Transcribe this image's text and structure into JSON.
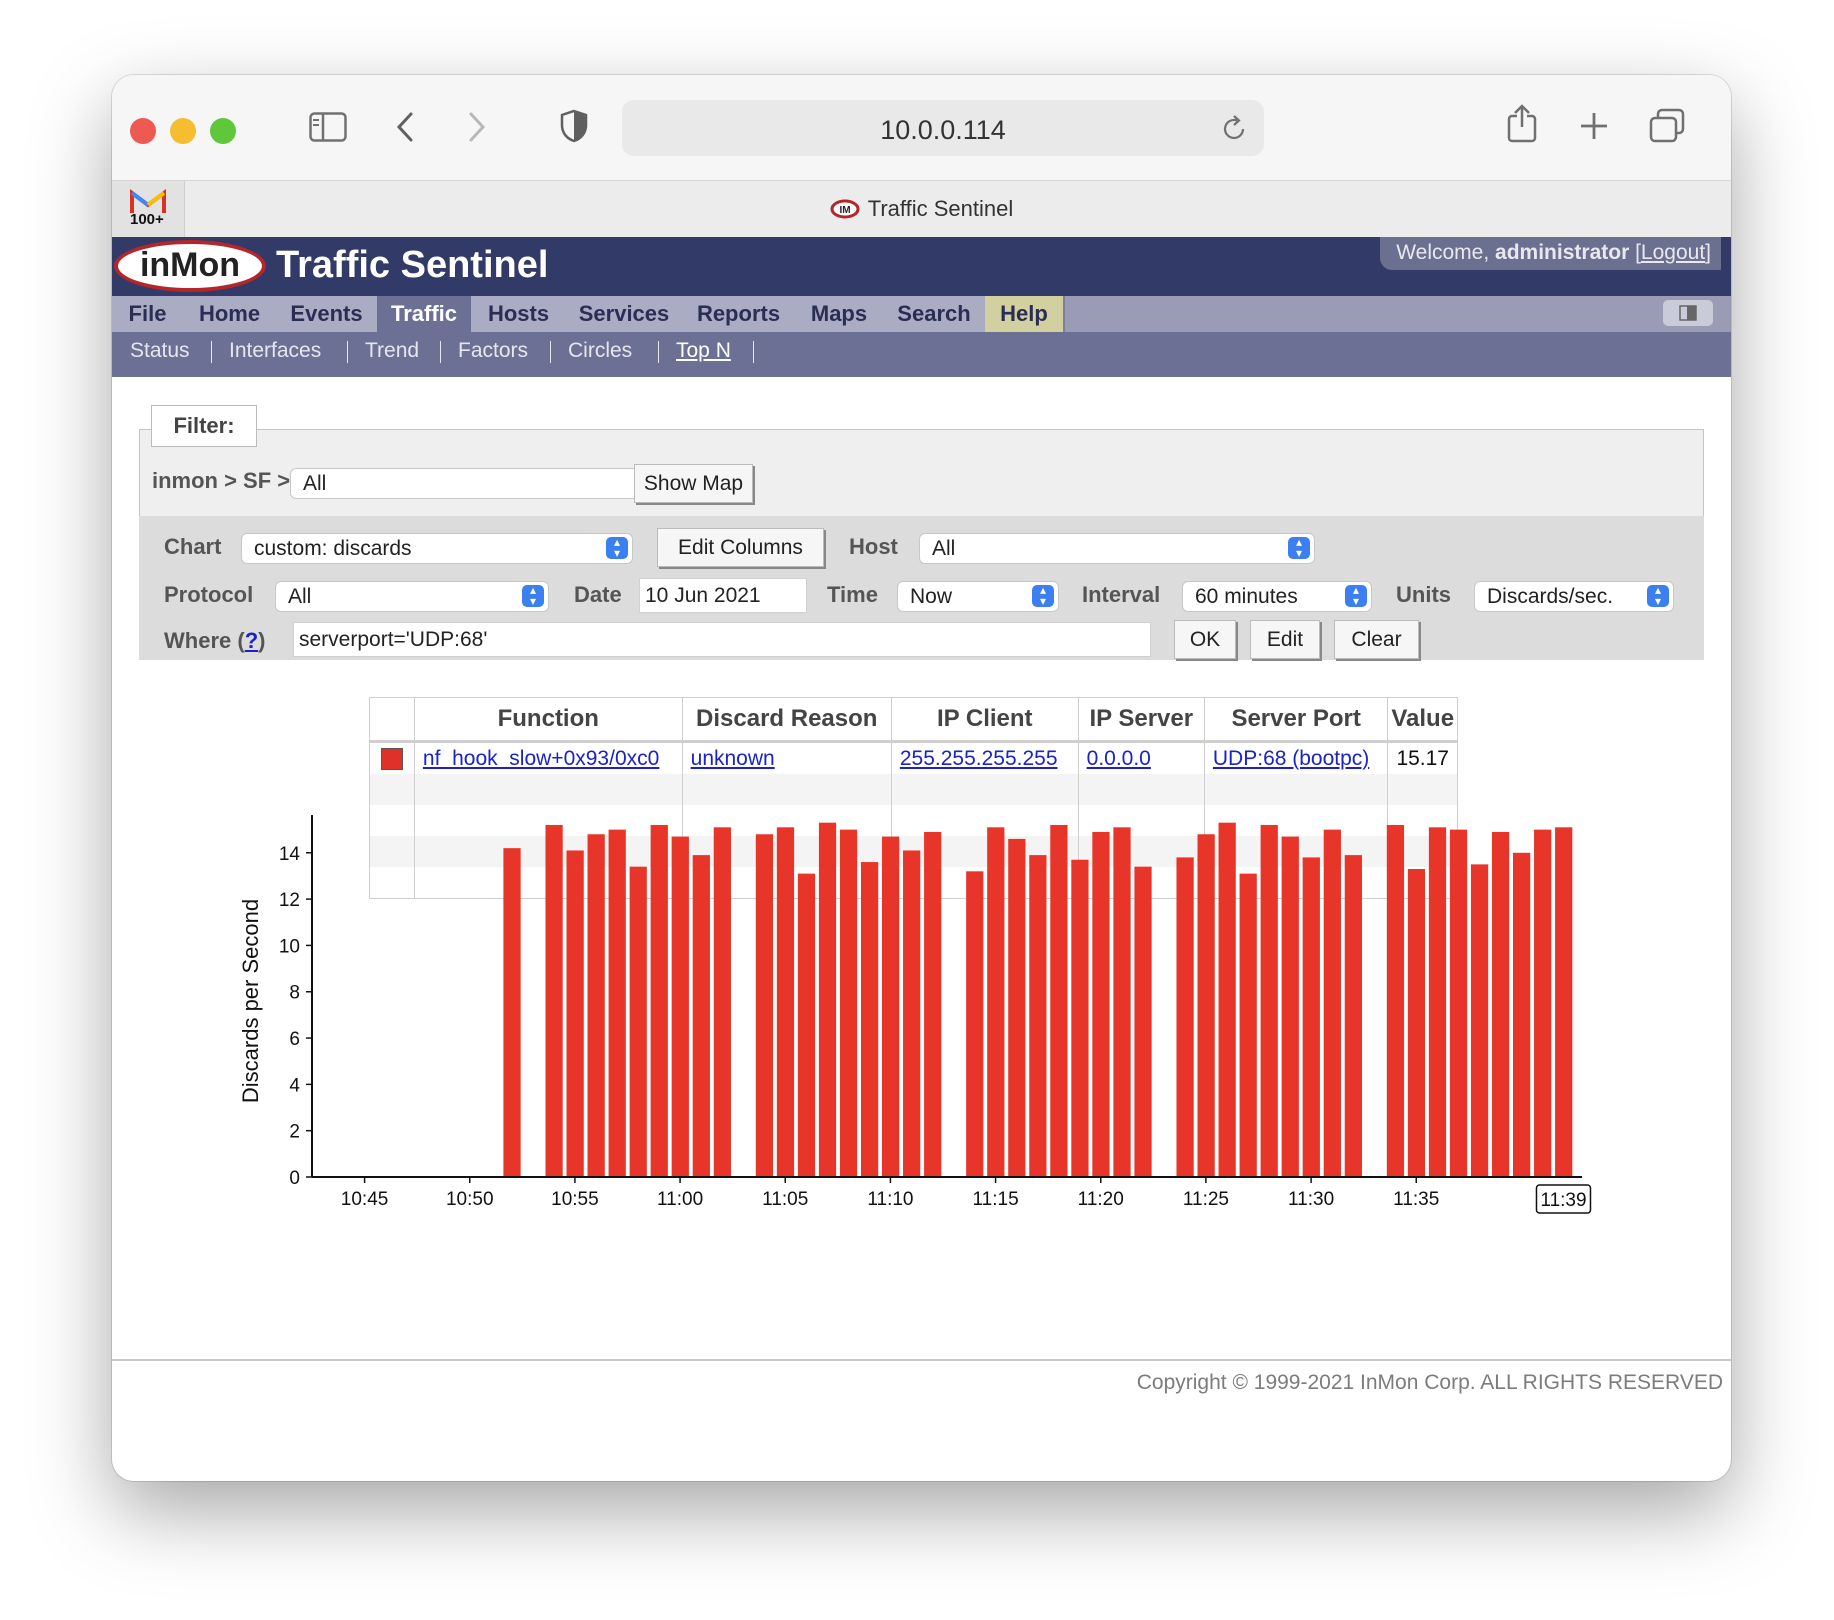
{
  "browser": {
    "url": "10.0.0.114",
    "tab_title": "Traffic Sentinel",
    "favicon_badge": "100+",
    "colors": {
      "close": "#ee5a52",
      "minimize": "#f5bd2f",
      "zoom": "#5fc73a"
    },
    "icons": [
      "sidebar-icon",
      "back-icon",
      "forward-icon",
      "shield-icon",
      "reload-icon",
      "share-icon",
      "new-tab-icon",
      "tab-overview-icon"
    ]
  },
  "header": {
    "logo": "inMon",
    "title": "Traffic Sentinel",
    "welcome_prefix": "Welcome,",
    "user": "administrator",
    "logout": "Logout"
  },
  "menu": [
    "File",
    "Home",
    "Events",
    "Traffic",
    "Hosts",
    "Services",
    "Reports",
    "Maps",
    "Search",
    "Help"
  ],
  "menu_active": "Traffic",
  "submenu": [
    "Status",
    "Interfaces",
    "Trend",
    "Factors",
    "Circles",
    "Top N"
  ],
  "submenu_active": "Top N",
  "filter": {
    "label": "Filter:",
    "path": "inmon > SF >",
    "path_value": "All",
    "show_map": "Show Map"
  },
  "form": {
    "chart_label": "Chart",
    "chart_value": "custom: discards",
    "edit_columns": "Edit Columns",
    "host_label": "Host",
    "host_value": "All",
    "protocol_label": "Protocol",
    "protocol_value": "All",
    "date_label": "Date",
    "date_value": "10 Jun 2021",
    "time_label": "Time",
    "time_value": "Now",
    "interval_label": "Interval",
    "interval_value": "60 minutes",
    "units_label": "Units",
    "units_value": "Discards/sec.",
    "where_label": "Where",
    "where_help": "?",
    "where_value": "serverport='UDP:68'",
    "ok": "OK",
    "edit": "Edit",
    "clear": "Clear"
  },
  "table": {
    "headers": [
      "Function",
      "Discard Reason",
      "IP Client",
      "IP Server",
      "Server Port",
      "Value"
    ],
    "rows": [
      {
        "function": "nf_hook_slow+0x93/0xc0",
        "reason": "unknown",
        "client": "255.255.255.255",
        "server": "0.0.0.0",
        "port": "UDP:68 (bootpc)",
        "value": "15.17"
      }
    ]
  },
  "chart_data": {
    "type": "bar",
    "ylabel": "Discards per Second",
    "ylim": [
      0,
      15.2
    ],
    "yticks": [
      0,
      2,
      4,
      6,
      8,
      10,
      12,
      14
    ],
    "xticks": [
      "10:45",
      "10:50",
      "10:55",
      "11:00",
      "11:05",
      "11:10",
      "11:15",
      "11:20",
      "11:25",
      "11:30",
      "11:35"
    ],
    "current_time_label": "11:39",
    "color": "#e8352a",
    "values": [
      0,
      0,
      0,
      0,
      0,
      0,
      0,
      0,
      0,
      14.2,
      0,
      15.2,
      14.1,
      14.8,
      15.0,
      13.4,
      15.2,
      14.7,
      13.9,
      15.1,
      0,
      14.8,
      15.1,
      13.1,
      15.3,
      15.0,
      13.6,
      14.7,
      14.1,
      14.9,
      0,
      13.2,
      15.1,
      14.6,
      13.9,
      15.2,
      13.7,
      14.9,
      15.1,
      13.4,
      0,
      13.8,
      14.8,
      15.3,
      13.1,
      15.2,
      14.7,
      13.8,
      15.0,
      13.9,
      0,
      15.2,
      13.3,
      15.1,
      15.0,
      13.5,
      14.9,
      14.0,
      15.0,
      15.1
    ]
  },
  "footer": {
    "copyright": "Copyright © 1999-2021 InMon Corp. ALL RIGHTS RESERVED"
  }
}
